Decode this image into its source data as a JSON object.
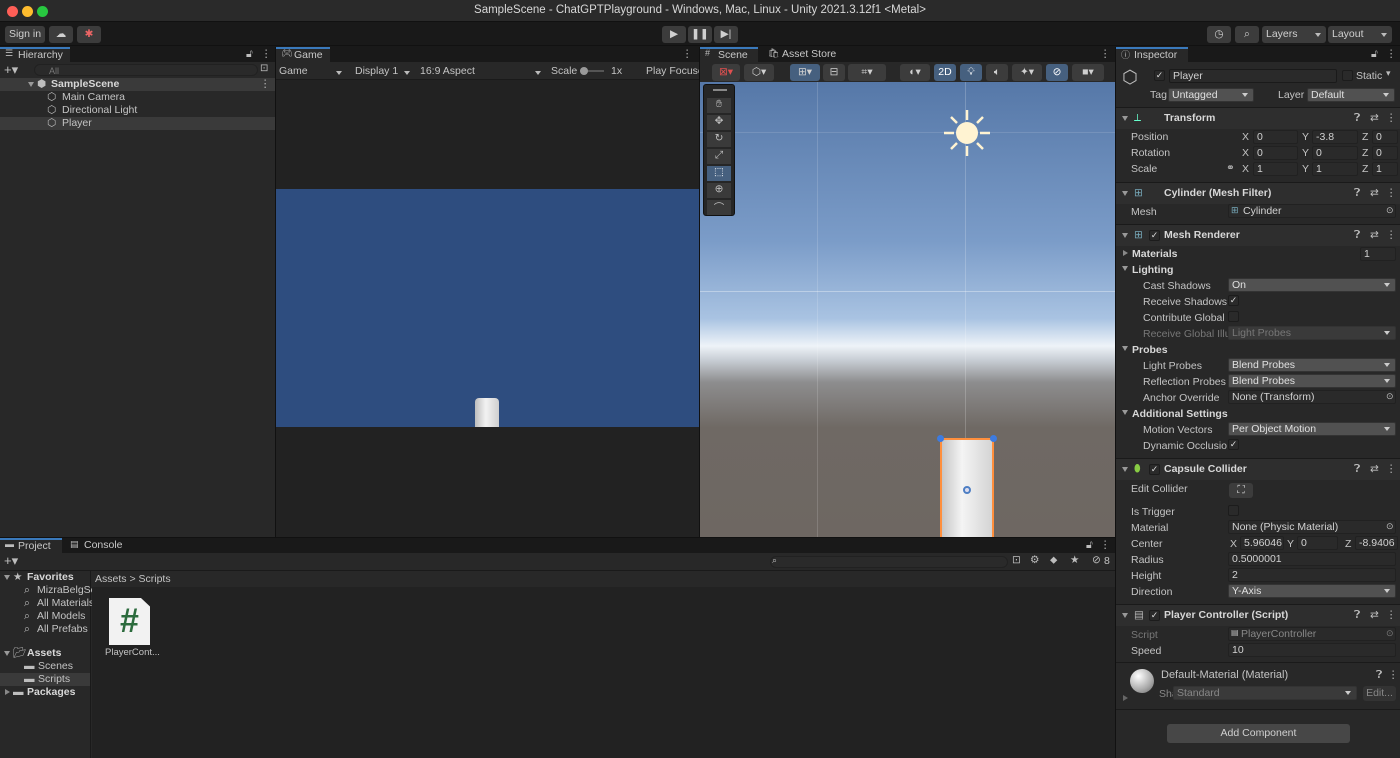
{
  "window": {
    "title": "SampleScene - ChatGPTPlayground - Windows, Mac, Linux - Unity 2021.3.12f1 <Metal>"
  },
  "toolbar": {
    "signin": "Sign in",
    "layers": "Layers",
    "layout": "Layout"
  },
  "hierarchy": {
    "tab": "Hierarchy",
    "search": "All",
    "scene": "SampleScene",
    "items": [
      "Main Camera",
      "Directional Light",
      "Player"
    ]
  },
  "game": {
    "tab": "Game",
    "mode": "Game",
    "display": "Display 1",
    "aspect": "16:9 Aspect",
    "scale_label": "Scale",
    "scale_value": "1x",
    "play_focus": "Play Focuse"
  },
  "scene": {
    "tab": "Scene",
    "asset_store": "Asset Store",
    "btn_2d": "2D"
  },
  "project": {
    "tab": "Project",
    "console": "Console",
    "badge": "8",
    "favorites": "Favorites",
    "fav_items": [
      "MizraBelgSe",
      "All Materials",
      "All Models",
      "All Prefabs"
    ],
    "assets": "Assets",
    "asset_folders": [
      "Scenes",
      "Scripts"
    ],
    "packages": "Packages",
    "breadcrumb_root": "Assets",
    "breadcrumb_sep": ">",
    "breadcrumb_leaf": "Scripts",
    "file_name": "PlayerCont...",
    "file_glyph": "#"
  },
  "inspector": {
    "tab": "Inspector",
    "object_name": "Player",
    "static": "Static",
    "tag_label": "Tag",
    "tag": "Untagged",
    "layer_label": "Layer",
    "layer": "Default",
    "transform": {
      "title": "Transform",
      "position": "Position",
      "rotation": "Rotation",
      "scale": "Scale",
      "x": "X",
      "y": "Y",
      "z": "Z",
      "pos": [
        "0",
        "-3.8",
        "0"
      ],
      "rot": [
        "0",
        "0",
        "0"
      ],
      "scl": [
        "1",
        "1",
        "1"
      ]
    },
    "mesh_filter": {
      "title": "Cylinder (Mesh Filter)",
      "mesh_label": "Mesh",
      "mesh": "Cylinder"
    },
    "mesh_renderer": {
      "title": "Mesh Renderer",
      "materials": "Materials",
      "materials_count": "1",
      "lighting": "Lighting",
      "cast_shadows": "Cast Shadows",
      "cast_shadows_val": "On",
      "receive_shadows": "Receive Shadows",
      "contribute_gi": "Contribute Global I",
      "receive_gi": "Receive Global Illu",
      "receive_gi_val": "Light Probes",
      "probes": "Probes",
      "light_probes": "Light Probes",
      "light_probes_val": "Blend Probes",
      "reflection_probes": "Reflection Probes",
      "reflection_probes_val": "Blend Probes",
      "anchor_override": "Anchor Override",
      "anchor_override_val": "None (Transform)",
      "additional": "Additional Settings",
      "motion_vectors": "Motion Vectors",
      "motion_vectors_val": "Per Object Motion",
      "dynamic_occlusion": "Dynamic Occlusio"
    },
    "capsule": {
      "title": "Capsule Collider",
      "edit_collider": "Edit Collider",
      "is_trigger": "Is Trigger",
      "material": "Material",
      "material_val": "None (Physic Material)",
      "center": "Center",
      "center_x": "5.96046",
      "center_y": "0",
      "center_z": "-8.9406",
      "radius": "Radius",
      "radius_val": "0.5000001",
      "height": "Height",
      "height_val": "2",
      "direction": "Direction",
      "direction_val": "Y-Axis"
    },
    "script": {
      "title": "Player Controller (Script)",
      "script_label": "Script",
      "script_val": "PlayerController",
      "speed_label": "Speed",
      "speed_val": "10"
    },
    "material": {
      "title": "Default-Material (Material)",
      "shader_label": "Shader",
      "shader_val": "Standard",
      "edit": "Edit..."
    },
    "add_component": "Add Component"
  },
  "colors": {
    "accent": "#3a79bb",
    "selection": "#ff8f3d",
    "sky": "#2e4d7f"
  }
}
